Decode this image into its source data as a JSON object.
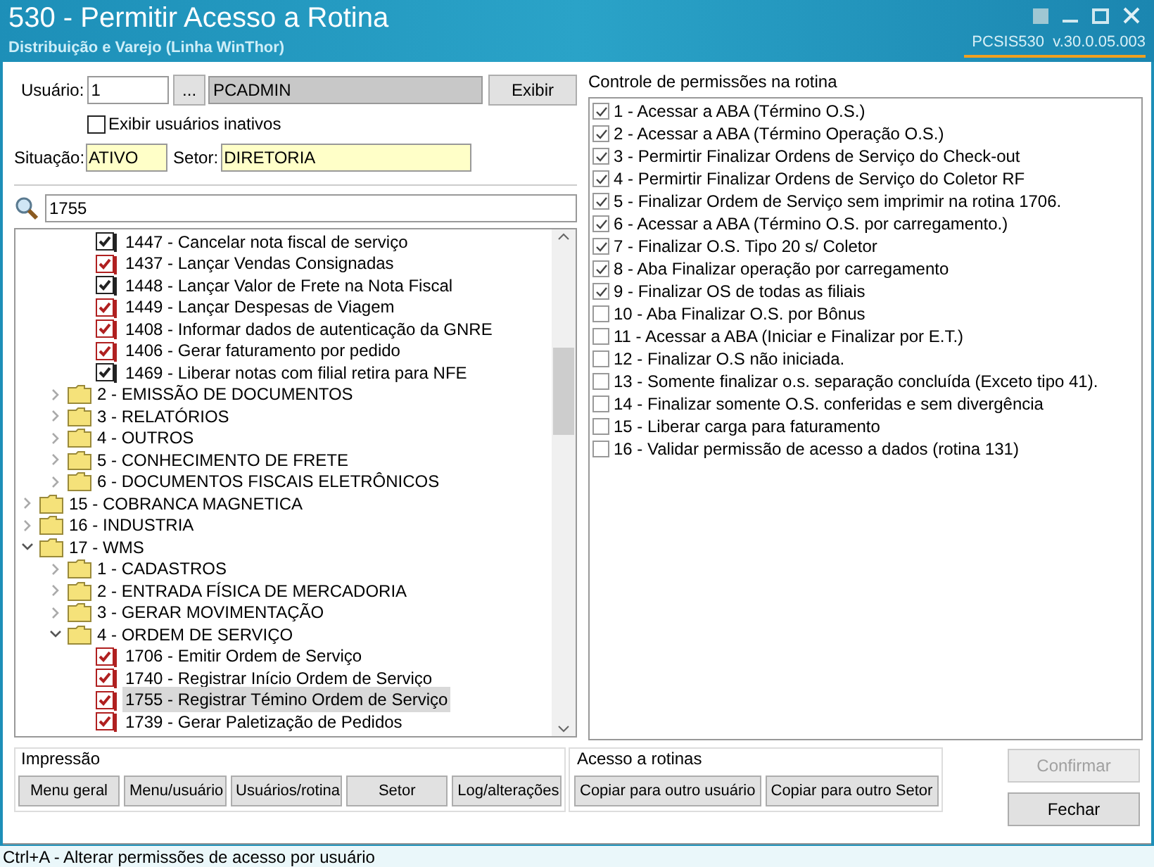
{
  "window": {
    "title": "530 - Permitir Acesso a Rotina",
    "subtitle": "Distribuição e Varejo (Linha WinThor)",
    "version": "PCSIS530  v.30.0.05.003"
  },
  "user": {
    "label": "Usuário:",
    "code": "1",
    "lookup_button": "...",
    "name": "PCADMIN",
    "show_button": "Exibir"
  },
  "show_inactive": {
    "label": "Exibir usuários inativos",
    "checked": false
  },
  "situation": {
    "label": "Situação:",
    "value": "ATIVO"
  },
  "sector": {
    "label": "Setor:",
    "value": "DIRETORIA"
  },
  "search": {
    "value": "1755"
  },
  "tree": [
    {
      "children": [
        {
          "children": [
            {
              "label": "1447 - Cancelar nota fiscal de serviço",
              "checked": true,
              "color": "#222222",
              "selected": false
            },
            {
              "label": "1437 - Lançar Vendas Consignadas",
              "checked": true,
              "color": "#b02020",
              "selected": false
            },
            {
              "label": "1448 - Lançar Valor de Frete na Nota Fiscal",
              "checked": true,
              "color": "#222222",
              "selected": false
            },
            {
              "label": "1449 - Lançar Despesas de Viagem",
              "checked": true,
              "color": "#b02020",
              "selected": false
            },
            {
              "label": "1408 - Informar dados de autenticação da GNRE",
              "checked": true,
              "color": "#b02020",
              "selected": false
            },
            {
              "label": "1406 - Gerar faturamento por pedido",
              "checked": true,
              "color": "#b02020",
              "selected": false
            },
            {
              "label": "1469 - Liberar notas com filial retira para NFE",
              "checked": true,
              "color": "#222222",
              "selected": false
            }
          ]
        },
        {
          "label": "2 - EMISSÃO DE DOCUMENTOS",
          "expanded": false
        },
        {
          "label": "3 - RELATÓRIOS",
          "expanded": false
        },
        {
          "label": "4 - OUTROS",
          "expanded": false
        },
        {
          "label": "5 - CONHECIMENTO DE FRETE",
          "expanded": false
        },
        {
          "label": "6 - DOCUMENTOS FISCAIS ELETRÔNICOS",
          "expanded": false
        }
      ]
    },
    {
      "label": "15 - COBRANCA MAGNETICA",
      "expanded": false
    },
    {
      "label": "16 - INDUSTRIA",
      "expanded": false
    },
    {
      "label": "17 - WMS",
      "expanded": true,
      "children": [
        {
          "label": "1 - CADASTROS",
          "expanded": false
        },
        {
          "label": "2 - ENTRADA FÍSICA DE MERCADORIA",
          "expanded": false
        },
        {
          "label": "3 - GERAR MOVIMENTAÇÃO",
          "expanded": false
        },
        {
          "label": "4 - ORDEM DE SERVIÇO",
          "expanded": true,
          "children": [
            {
              "label": "1706 - Emitir Ordem de Serviço",
              "checked": true,
              "color": "#b02020",
              "selected": false
            },
            {
              "label": "1740 - Registrar Início Ordem de Serviço",
              "checked": true,
              "color": "#b02020",
              "selected": false
            },
            {
              "label": "1755 - Registrar Témino Ordem de Serviço",
              "checked": true,
              "color": "#b02020",
              "selected": true
            },
            {
              "label": "1739 - Gerar Paletização de Pedidos",
              "checked": true,
              "color": "#b02020",
              "selected": false
            }
          ]
        }
      ]
    }
  ],
  "permissions": {
    "title": "Controle de permissões na rotina",
    "items": [
      {
        "label": "1 - Acessar a ABA (Término O.S.)",
        "checked": true
      },
      {
        "label": "2 - Acessar a ABA (Término Operação O.S.)",
        "checked": true
      },
      {
        "label": "3 - Permirtir Finalizar Ordens de Serviço do Check-out",
        "checked": true
      },
      {
        "label": "4 - Permirtir Finalizar Ordens de Serviço do Coletor RF",
        "checked": true
      },
      {
        "label": "5 - Finalizar Ordem de Serviço sem imprimir na rotina 1706.",
        "checked": true
      },
      {
        "label": "6 - Acessar a ABA (Término O.S. por carregamento.)",
        "checked": true
      },
      {
        "label": "7 - Finalizar O.S. Tipo 20 s/ Coletor",
        "checked": true
      },
      {
        "label": "8 - Aba Finalizar operação por carregamento",
        "checked": true
      },
      {
        "label": "9 - Finalizar OS de todas as filiais",
        "checked": true
      },
      {
        "label": "10 - Aba Finalizar O.S. por Bônus",
        "checked": false
      },
      {
        "label": "11 - Acessar a ABA (Iniciar e Finalizar por E.T.)",
        "checked": false
      },
      {
        "label": "12 - Finalizar O.S não iniciada.",
        "checked": false
      },
      {
        "label": "13 - Somente finalizar o.s. separação concluída (Exceto tipo 41).",
        "checked": false
      },
      {
        "label": "14 - Finalizar somente O.S. conferidas e sem divergência",
        "checked": false
      },
      {
        "label": "15 - Liberar carga para faturamento",
        "checked": false
      },
      {
        "label": "16 - Validar permissão de acesso a dados (rotina 131)",
        "checked": false
      }
    ]
  },
  "printing": {
    "title": "Impressão",
    "buttons": [
      {
        "label": "Menu geral"
      },
      {
        "label": "Menu/usuário"
      },
      {
        "label": "Usuários/rotina"
      },
      {
        "label": "Setor"
      },
      {
        "label": "Log/alterações"
      }
    ]
  },
  "access": {
    "title": "Acesso a rotinas",
    "buttons": [
      {
        "label": "Copiar para outro usuário"
      },
      {
        "label": "Copiar para outro Setor"
      }
    ]
  },
  "actions": [
    {
      "label": "Confirmar",
      "disabled": true
    },
    {
      "label": "Fechar",
      "disabled": false
    }
  ],
  "status_bar": "Ctrl+A - Alterar permissões de acesso por usuário"
}
